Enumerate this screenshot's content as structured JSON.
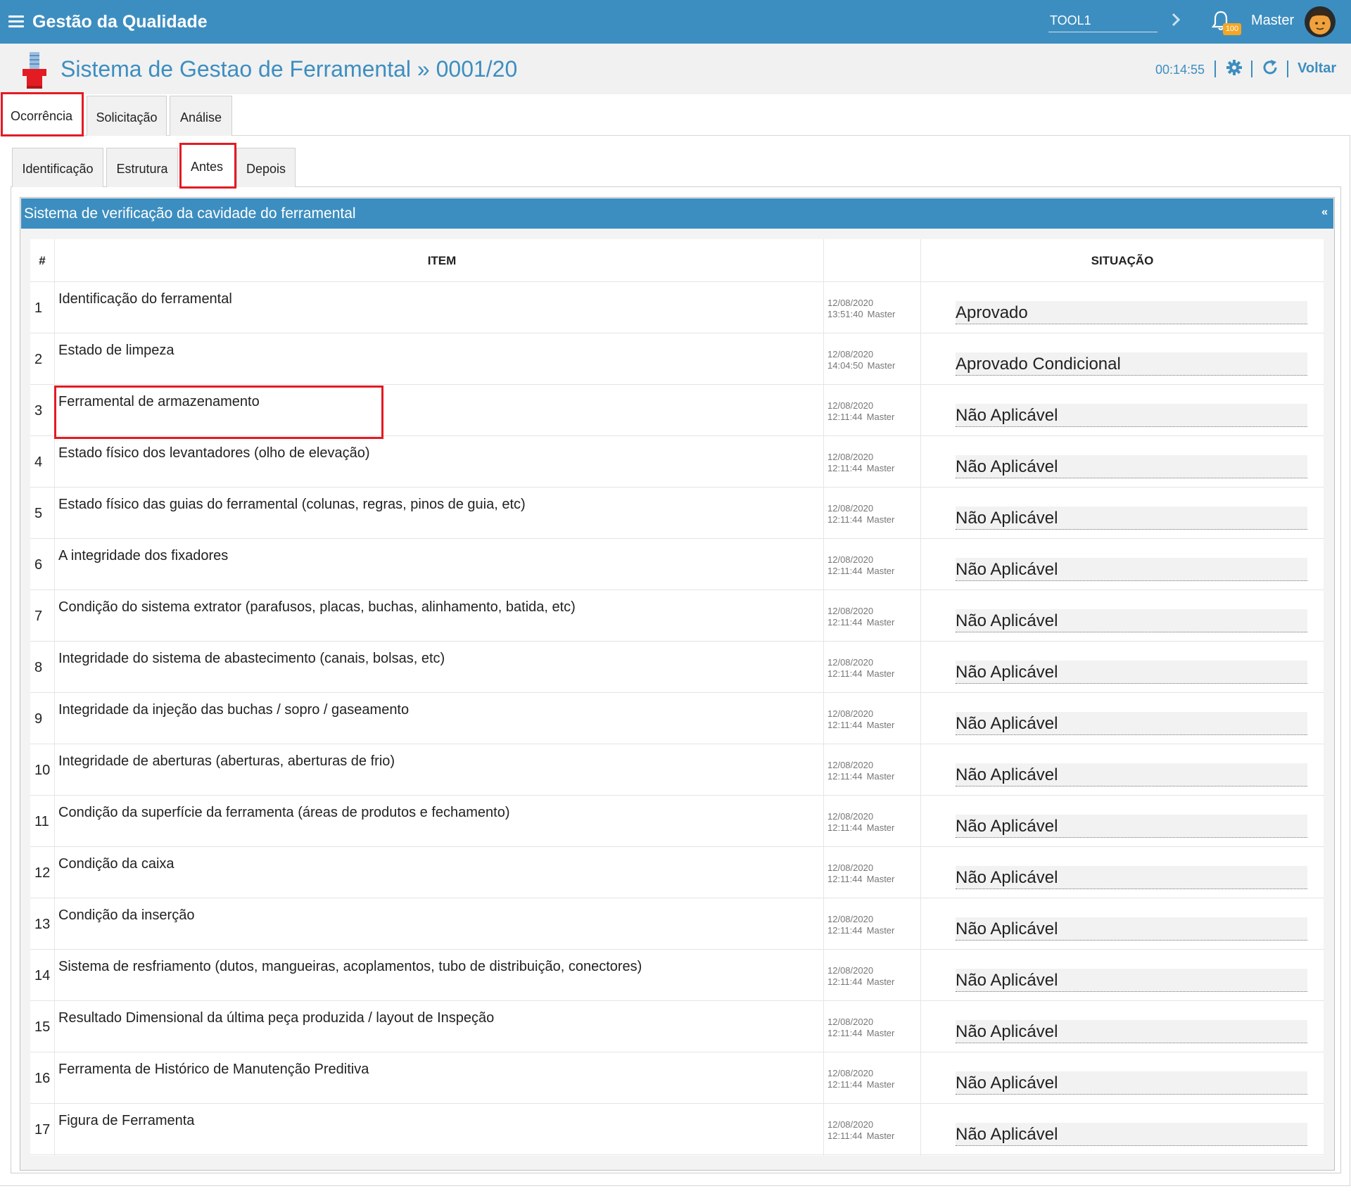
{
  "topbar": {
    "app_title": "Gestão da Qualidade",
    "tool_value": "TOOL1",
    "notification_count": "100",
    "user_name": "Master"
  },
  "header": {
    "title": "Sistema de Gestao de Ferramental » 0001/20",
    "timer": "00:14:55",
    "back_label": "Voltar"
  },
  "main_tabs": [
    {
      "label": "Ocorrência",
      "active": true
    },
    {
      "label": "Solicitação",
      "active": false
    },
    {
      "label": "Análise",
      "active": false
    }
  ],
  "sub_tabs": [
    {
      "label": "Identificação",
      "active": false
    },
    {
      "label": "Estrutura",
      "active": false
    },
    {
      "label": "Antes",
      "active": true
    },
    {
      "label": "Depois",
      "active": false
    }
  ],
  "section": {
    "title": "Sistema de verificação da cavidade do ferramental",
    "collapse_glyph": "«"
  },
  "table": {
    "columns": {
      "num": "#",
      "item": "ITEM",
      "situation": "SITUAÇÃO"
    },
    "rows": [
      {
        "num": "1",
        "item": "Identificação do ferramental",
        "date": "12/08/2020",
        "time": "13:51:40",
        "user": "Master",
        "status": "Aprovado",
        "icon": "check-circle-icon"
      },
      {
        "num": "2",
        "item": "Estado de limpeza",
        "date": "12/08/2020",
        "time": "14:04:50",
        "user": "Master",
        "status": "Aprovado Condicional",
        "icon": "warning-icon"
      },
      {
        "num": "3",
        "item": "Ferramental de armazenamento",
        "date": "12/08/2020",
        "time": "12:11:44",
        "user": "Master",
        "status": "Não Aplicável",
        "icon": "not-applicable-icon"
      },
      {
        "num": "4",
        "item": "Estado físico dos levantadores (olho de elevação)",
        "date": "12/08/2020",
        "time": "12:11:44",
        "user": "Master",
        "status": "Não Aplicável",
        "icon": "not-applicable-icon"
      },
      {
        "num": "5",
        "item": "Estado físico das guias do ferramental (colunas, regras, pinos de guia, etc)",
        "date": "12/08/2020",
        "time": "12:11:44",
        "user": "Master",
        "status": "Não Aplicável",
        "icon": "not-applicable-icon"
      },
      {
        "num": "6",
        "item": "A integridade dos fixadores",
        "date": "12/08/2020",
        "time": "12:11:44",
        "user": "Master",
        "status": "Não Aplicável",
        "icon": "not-applicable-icon"
      },
      {
        "num": "7",
        "item": "Condição do sistema extrator (parafusos, placas, buchas, alinhamento, batida, etc)",
        "date": "12/08/2020",
        "time": "12:11:44",
        "user": "Master",
        "status": "Não Aplicável",
        "icon": "not-applicable-icon"
      },
      {
        "num": "8",
        "item": "Integridade do sistema de abastecimento (canais, bolsas, etc)",
        "date": "12/08/2020",
        "time": "12:11:44",
        "user": "Master",
        "status": "Não Aplicável",
        "icon": "not-applicable-icon"
      },
      {
        "num": "9",
        "item": "Integridade da injeção das buchas / sopro / gaseamento",
        "date": "12/08/2020",
        "time": "12:11:44",
        "user": "Master",
        "status": "Não Aplicável",
        "icon": "not-applicable-icon"
      },
      {
        "num": "10",
        "item": "Integridade de aberturas (aberturas, aberturas de frio)",
        "date": "12/08/2020",
        "time": "12:11:44",
        "user": "Master",
        "status": "Não Aplicável",
        "icon": "not-applicable-icon"
      },
      {
        "num": "11",
        "item": "Condição da superfície da ferramenta (áreas de produtos e fechamento)",
        "date": "12/08/2020",
        "time": "12:11:44",
        "user": "Master",
        "status": "Não Aplicável",
        "icon": "not-applicable-icon"
      },
      {
        "num": "12",
        "item": "Condição da caixa",
        "date": "12/08/2020",
        "time": "12:11:44",
        "user": "Master",
        "status": "Não Aplicável",
        "icon": "not-applicable-icon"
      },
      {
        "num": "13",
        "item": "Condição da inserção",
        "date": "12/08/2020",
        "time": "12:11:44",
        "user": "Master",
        "status": "Não Aplicável",
        "icon": "not-applicable-icon"
      },
      {
        "num": "14",
        "item": "Sistema de resfriamento (dutos, mangueiras, acoplamentos, tubo de distribuição, conectores)",
        "date": "12/08/2020",
        "time": "12:11:44",
        "user": "Master",
        "status": "Não Aplicável",
        "icon": "not-applicable-icon"
      },
      {
        "num": "15",
        "item": "Resultado Dimensional da última peça produzida / layout de Inspeção",
        "date": "12/08/2020",
        "time": "12:11:44",
        "user": "Master",
        "status": "Não Aplicável",
        "icon": "not-applicable-icon"
      },
      {
        "num": "16",
        "item": "Ferramenta de Histórico de Manutenção Preditiva",
        "date": "12/08/2020",
        "time": "12:11:44",
        "user": "Master",
        "status": "Não Aplicável",
        "icon": "not-applicable-icon"
      },
      {
        "num": "17",
        "item": "Figura de Ferramenta",
        "date": "12/08/2020",
        "time": "12:11:44",
        "user": "Master",
        "status": "Não Aplicável",
        "icon": "not-applicable-icon"
      }
    ]
  },
  "colors": {
    "primary": "#3d8ec0",
    "highlight": "#e31b23",
    "approved": "#3cb043",
    "conditional": "#f2c200",
    "not_applicable": "#9a9a9a"
  }
}
